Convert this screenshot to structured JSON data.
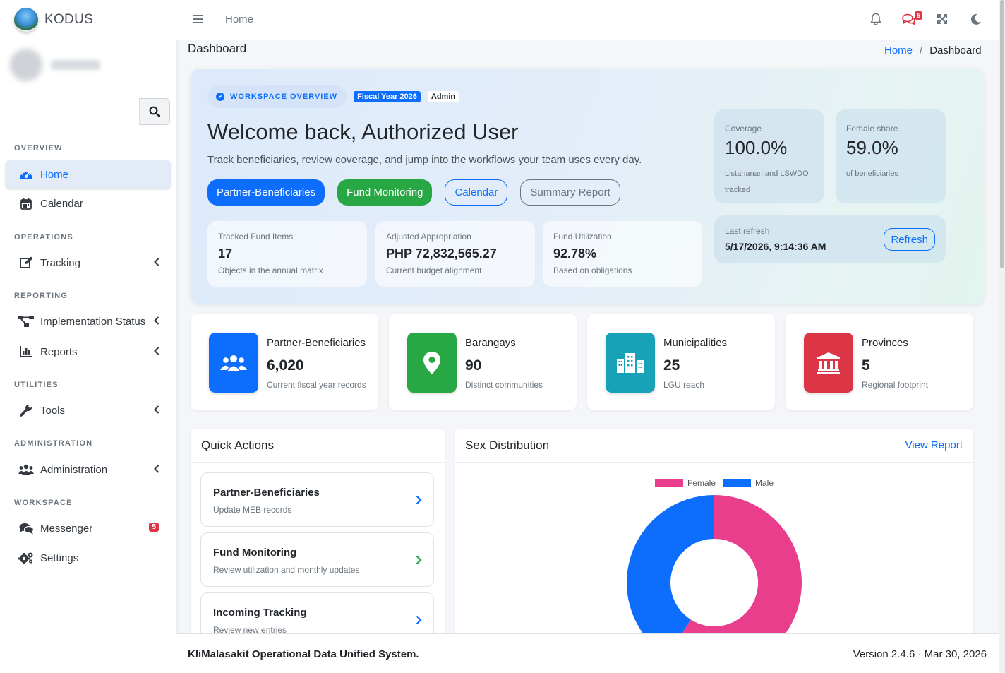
{
  "app": {
    "brand": "KODUS"
  },
  "sidebar": {
    "sections": {
      "overview": "OVERVIEW",
      "operations": "OPERATIONS",
      "reporting": "REPORTING",
      "utilities": "UTILITIES",
      "administration": "ADMINISTRATION",
      "workspace": "WORKSPACE"
    },
    "items": {
      "home": "Home",
      "calendar": "Calendar",
      "tracking": "Tracking",
      "implementation_status": "Implementation Status",
      "reports": "Reports",
      "tools": "Tools",
      "administration": "Administration",
      "messenger": "Messenger",
      "messenger_badge": "5",
      "settings": "Settings"
    }
  },
  "topbar": {
    "home_link": "Home",
    "messages_badge": "5"
  },
  "page": {
    "title": "Dashboard",
    "breadcrumb": {
      "home": "Home",
      "separator": "/",
      "current": "Dashboard"
    }
  },
  "hero": {
    "pill": "WORKSPACE OVERVIEW",
    "fiscal_year": "Fiscal Year 2026",
    "role": "Admin",
    "welcome": "Welcome back, Authorized User",
    "subtitle": "Track beneficiaries, review coverage, and jump into the workflows your team uses every day.",
    "buttons": {
      "partner": "Partner-Beneficiaries",
      "fund": "Fund Monitoring",
      "calendar": "Calendar",
      "summary": "Summary Report"
    },
    "mini_cards": [
      {
        "label": "Tracked Fund Items",
        "value": "17",
        "sub": "Objects in the annual matrix"
      },
      {
        "label": "Adjusted Appropriation",
        "value": "PHP 72,832,565.27",
        "sub": "Current budget alignment"
      },
      {
        "label": "Fund Utilization",
        "value": "92.78%",
        "sub": "Based on obligations"
      }
    ],
    "coverage": {
      "label": "Coverage",
      "value": "100.0%",
      "sub": "Listahanan and LSWDO tracked"
    },
    "female_share": {
      "label": "Female share",
      "value": "59.0%",
      "sub": "of beneficiaries"
    },
    "refresh": {
      "label": "Last refresh",
      "time": "5/17/2026, 9:14:36 AM",
      "button": "Refresh"
    }
  },
  "info_boxes": [
    {
      "label": "Partner-Beneficiaries",
      "value": "6,020",
      "sub": "Current fiscal year records",
      "color": "#0d6efd",
      "icon": "users-icon"
    },
    {
      "label": "Barangays",
      "value": "90",
      "sub": "Distinct communities",
      "color": "#28a745",
      "icon": "map-marker-icon"
    },
    {
      "label": "Municipalities",
      "value": "25",
      "sub": "LGU reach",
      "color": "#17a2b8",
      "icon": "city-icon"
    },
    {
      "label": "Provinces",
      "value": "5",
      "sub": "Regional footprint",
      "color": "#dc3545",
      "icon": "landmark-icon"
    }
  ],
  "quick_actions": {
    "title": "Quick Actions",
    "items": [
      {
        "title": "Partner-Beneficiaries",
        "sub": "Update MEB records"
      },
      {
        "title": "Fund Monitoring",
        "sub": "Review utilization and monthly updates"
      },
      {
        "title": "Incoming Tracking",
        "sub": "Review new entries"
      }
    ]
  },
  "sex_distribution": {
    "title": "Sex Distribution",
    "link": "View Report"
  },
  "chart_data": {
    "type": "pie",
    "categories": [
      "Female",
      "Male"
    ],
    "values": [
      59.0,
      41.0
    ],
    "colors": [
      "#e83e8c",
      "#0d6efd"
    ],
    "legend": "top"
  },
  "footer": {
    "left": "KliMalasakit Operational Data Unified System.",
    "right": "Version 2.4.6 · Mar 30, 2026"
  }
}
